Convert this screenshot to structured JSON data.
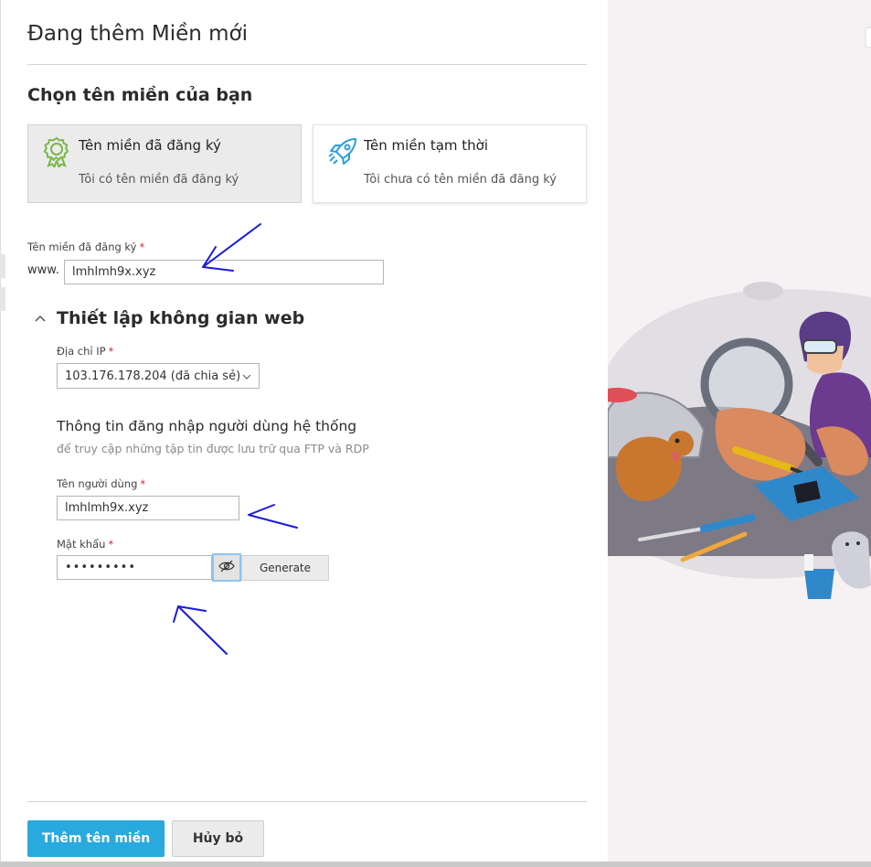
{
  "dialog": {
    "title": "Đang thêm Miền mới",
    "choose_domain_title": "Chọn tên miền của bạn"
  },
  "domain_options": [
    {
      "title": "Tên miền đã đăng ký",
      "subtitle": "Tôi có tên miền đã đăng ký",
      "icon": "award-icon",
      "selected": true
    },
    {
      "title": "Tên miền tạm thời",
      "subtitle": "Tôi chưa có tên miền đã đăng ký",
      "icon": "rocket-icon",
      "selected": false
    }
  ],
  "domain_field": {
    "label": "Tên miền đã đăng ký",
    "required_mark": "*",
    "prefix": "www.",
    "value": "lmhlmh9x.xyz"
  },
  "hosting": {
    "section_title": "Thiết lập không gian web",
    "ip_label": "Địa chỉ IP",
    "ip_value": "103.176.178.204 (đã chia sẻ)",
    "login_title": "Thông tin đăng nhập người dùng hệ thống",
    "login_desc": "để truy cập những tập tin được lưu trữ qua FTP và RDP",
    "username_label": "Tên người dùng",
    "username_value": "lmhlmh9x.xyz",
    "password_label": "Mật khẩu",
    "password_value": "•••••••••",
    "generate_label": "Generate"
  },
  "footer": {
    "submit_label": "Thêm tên miền",
    "cancel_label": "Hủy bỏ"
  },
  "colors": {
    "primary": "#28aade",
    "required": "#d0273e",
    "annotation": "#1a1adf",
    "award_icon": "#7ab648",
    "rocket_icon": "#2b9fd8"
  }
}
